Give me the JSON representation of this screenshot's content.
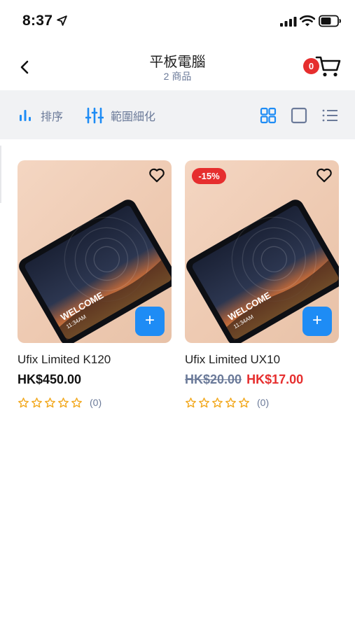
{
  "status_bar": {
    "time": "8:37"
  },
  "header": {
    "title": "平板電腦",
    "subtitle": "2 商品",
    "cart_count": "0"
  },
  "toolbar": {
    "sort_label": "排序",
    "filter_label": "範圍細化"
  },
  "colors": {
    "accent": "#1e8cf5",
    "sale": "#e62e2e",
    "muted": "#6b7a99",
    "star": "#f2a81d"
  },
  "products": [
    {
      "name": "Ufix Limited K120",
      "price": "HK$450.00",
      "review_count": "(0)",
      "rating": 0,
      "screen_text_1": "WELCOME",
      "screen_text_2": "11:34AM"
    },
    {
      "name": "Ufix Limited UX10",
      "discount": "-15%",
      "original_price": "HK$20.00",
      "sale_price": "HK$17.00",
      "review_count": "(0)",
      "rating": 0,
      "screen_text_1": "WELCOME",
      "screen_text_2": "11:34AM"
    }
  ]
}
